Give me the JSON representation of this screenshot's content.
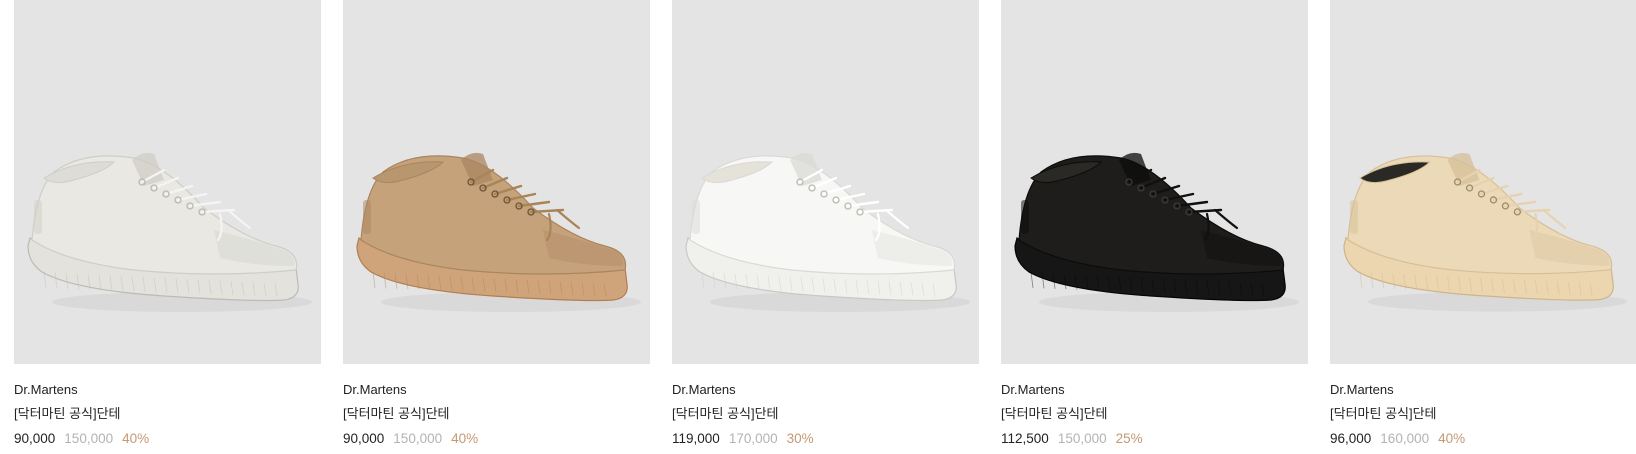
{
  "products": [
    {
      "brand": "Dr.Martens",
      "title": "[닥터마틴 공식]단테",
      "price": "90,000",
      "original_price": "150,000",
      "discount": "40%",
      "colors": {
        "upper": "#e9e8e3",
        "upper_shade": "#cfcdc6",
        "sole": "#e3e2dd",
        "sole_shade": "#bdbab2",
        "laces": "#f4f4f2",
        "eyelet": "#bab8b1",
        "lining": "#dedcd6"
      }
    },
    {
      "brand": "Dr.Martens",
      "title": "[닥터마틴 공식]단테",
      "price": "90,000",
      "original_price": "150,000",
      "discount": "40%",
      "colors": {
        "upper": "#c6a27b",
        "upper_shade": "#a98560",
        "sole": "#d0a47a",
        "sole_shade": "#b07e52",
        "laces": "#a88457",
        "eyelet": "#6b5338",
        "lining": "#b8976f"
      }
    },
    {
      "brand": "Dr.Martens",
      "title": "[닥터마틴 공식]단테",
      "price": "119,000",
      "original_price": "170,000",
      "discount": "30%",
      "colors": {
        "upper": "#f7f7f5",
        "upper_shade": "#d9d9d5",
        "sole": "#f0f0ed",
        "sole_shade": "#c9c8c3",
        "laces": "#ffffff",
        "eyelet": "#bcbab3",
        "lining": "#e5e2da"
      }
    },
    {
      "brand": "Dr.Martens",
      "title": "[닥터마틴 공식]단테",
      "price": "112,500",
      "original_price": "150,000",
      "discount": "25%",
      "colors": {
        "upper": "#1e1d1b",
        "upper_shade": "#0c0c0b",
        "sole": "#161616",
        "sole_shade": "#050505",
        "laces": "#101010",
        "eyelet": "#3b3a37",
        "lining": "#2a2926"
      }
    },
    {
      "brand": "Dr.Martens",
      "title": "[닥터마틴 공식]단테",
      "price": "96,000",
      "original_price": "160,000",
      "discount": "40%",
      "colors": {
        "upper": "#ecd9b8",
        "upper_shade": "#d6bf98",
        "sole": "#ecd6b0",
        "sole_shade": "#cfb389",
        "laces": "#e6d2ae",
        "eyelet": "#9c8b6f",
        "lining": "#2b2925"
      }
    }
  ]
}
